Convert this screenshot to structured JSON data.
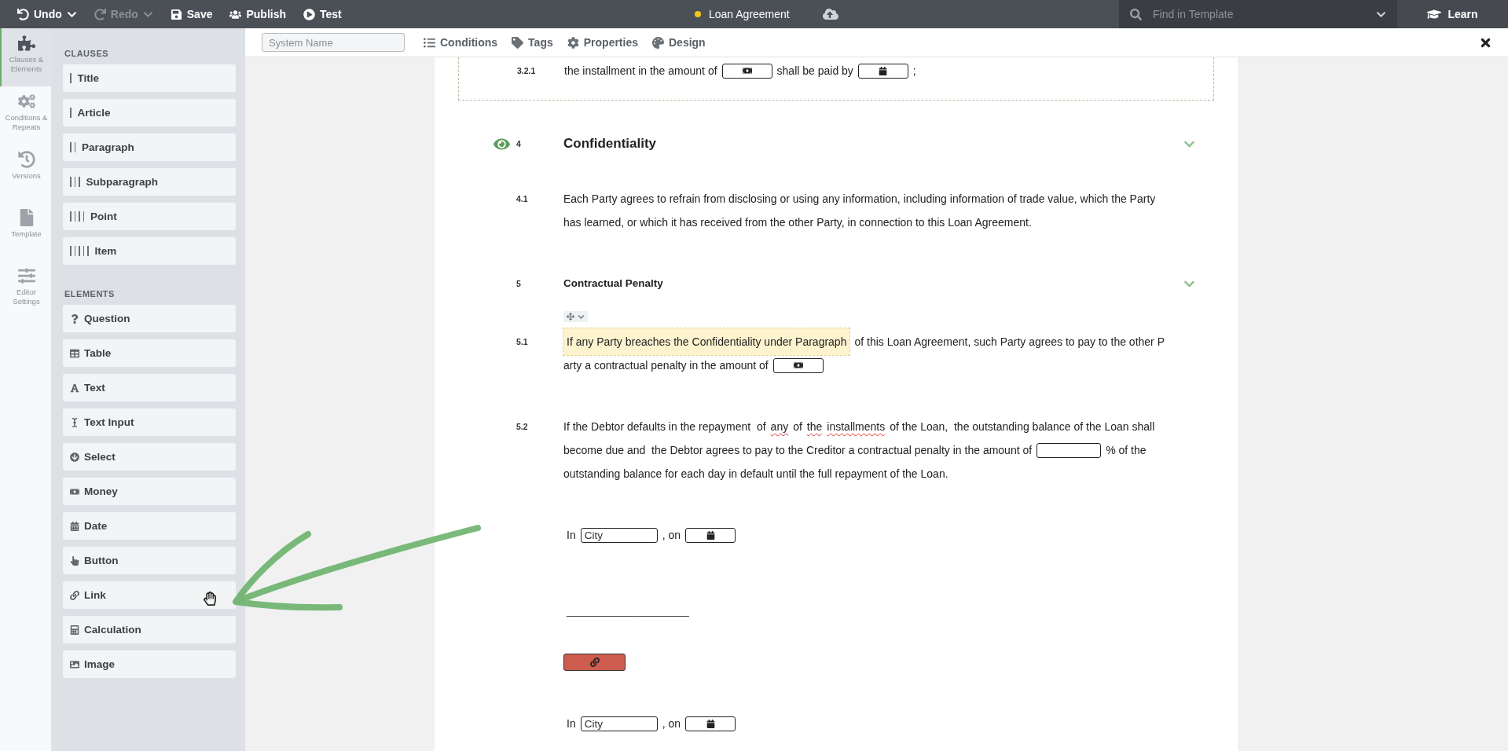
{
  "top_bar": {
    "actions": [
      {
        "label": "Undo",
        "disabled": false,
        "menu": true
      },
      {
        "label": "Redo",
        "disabled": true,
        "menu": true
      },
      {
        "label": "Save",
        "disabled": false,
        "menu": false
      },
      {
        "label": "Publish",
        "disabled": false,
        "menu": false
      },
      {
        "label": "Test",
        "disabled": false,
        "menu": false
      }
    ],
    "document_title": "Loan Agreement",
    "unsaved": true,
    "search": {
      "placeholder": "Find in Template"
    },
    "learn_button": "Learn"
  },
  "rail": {
    "items": [
      {
        "label": "Clauses & Elements",
        "selected": true
      },
      {
        "label": "Conditions & Repeats",
        "selected": false
      },
      {
        "label": "Versions",
        "selected": false
      },
      {
        "label": "Template",
        "selected": false
      },
      {
        "label": "Editor Settings",
        "selected": false
      }
    ]
  },
  "palette": {
    "sections": [
      {
        "heading": "CLAUSES",
        "kind": "clauses",
        "items": [
          "Title",
          "Article",
          "Paragraph",
          "Subparagraph",
          "Point",
          "Item"
        ]
      },
      {
        "heading": "ELEMENTS",
        "kind": "elements",
        "items": [
          "Question",
          "Table",
          "Text",
          "Text Input",
          "Select",
          "Money",
          "Date",
          "Button",
          "Link",
          "Calculation",
          "Image"
        ]
      }
    ]
  },
  "editor_toolbar": {
    "system_name": {
      "placeholder": "System Name"
    },
    "tabs": [
      "Conditions",
      "Tags",
      "Properties",
      "Design"
    ]
  },
  "document": {
    "blocks": [
      {
        "kind": "clause",
        "number": "3.2.1",
        "framed": true,
        "toolbar": false,
        "lines": [
          [
            {
              "kind": "text",
              "text": "the installment in the amount of"
            },
            {
              "kind": "money-field"
            },
            {
              "kind": "text",
              "text": "shall be paid by"
            },
            {
              "kind": "date-field"
            },
            {
              "kind": "text",
              "text": ";"
            }
          ]
        ]
      },
      {
        "kind": "title-heading",
        "number": "4",
        "title": "Confidentiality",
        "eye": true
      },
      {
        "kind": "clause",
        "number": "4.1",
        "framed": false,
        "toolbar": false,
        "lines": [
          [
            {
              "kind": "text",
              "text": "Each Party agrees to refrain from disclosing or using any information, including information of trade value, which the Party"
            }
          ],
          [
            {
              "kind": "text",
              "text": "has learned, or which it has received from the other Party, in connection to this Loan Agreement."
            }
          ]
        ]
      },
      {
        "kind": "article-heading",
        "number": "5",
        "title": "Contractual Penalty",
        "eye": false
      },
      {
        "kind": "clause",
        "number": "5.1",
        "framed": false,
        "toolbar": true,
        "lines": [
          [
            {
              "kind": "highlight",
              "text": "If any Party breaches the Confidentiality under Paragraph"
            },
            {
              "kind": "text",
              "text": "of this Loan Agreement, such Party agrees to pay to the other P"
            }
          ],
          [
            {
              "kind": "text",
              "text": "arty a contractual penalty in the amount of"
            },
            {
              "kind": "money-field"
            }
          ]
        ]
      },
      {
        "kind": "clause",
        "number": "5.2",
        "framed": false,
        "toolbar": false,
        "lines": [
          [
            {
              "kind": "text",
              "text": "If the Debtor defaults in the repayment  of"
            },
            {
              "kind": "misspelled",
              "text": "any"
            },
            {
              "kind": "text",
              "text": "of"
            },
            {
              "kind": "misspelled",
              "text": "the"
            },
            {
              "kind": "misspelled",
              "text": "installments"
            },
            {
              "kind": "text",
              "text": "of the Loan,  the outstanding balance of the Loan shall"
            }
          ],
          [
            {
              "kind": "text",
              "text": "become due and  the Debtor agrees to pay to the Creditor a contractual penalty in the amount of"
            },
            {
              "kind": "input-field"
            },
            {
              "kind": "text",
              "text": "% of the"
            }
          ],
          [
            {
              "kind": "text",
              "text": "outstanding balance for each day in default until the full repayment of the Loan."
            }
          ]
        ]
      },
      {
        "kind": "line",
        "segments": [
          {
            "kind": "text",
            "text": "In"
          },
          {
            "kind": "input-field",
            "placeholder": "City"
          },
          {
            "kind": "text",
            "text": ", on"
          },
          {
            "kind": "date-field"
          }
        ]
      },
      {
        "kind": "signature",
        "text": "____________________"
      },
      {
        "kind": "link-button"
      },
      {
        "kind": "line",
        "segments": [
          {
            "kind": "text",
            "text": "In"
          },
          {
            "kind": "input-field",
            "placeholder": "City"
          },
          {
            "kind": "text",
            "text": ", on"
          },
          {
            "kind": "date-field"
          }
        ]
      }
    ]
  }
}
